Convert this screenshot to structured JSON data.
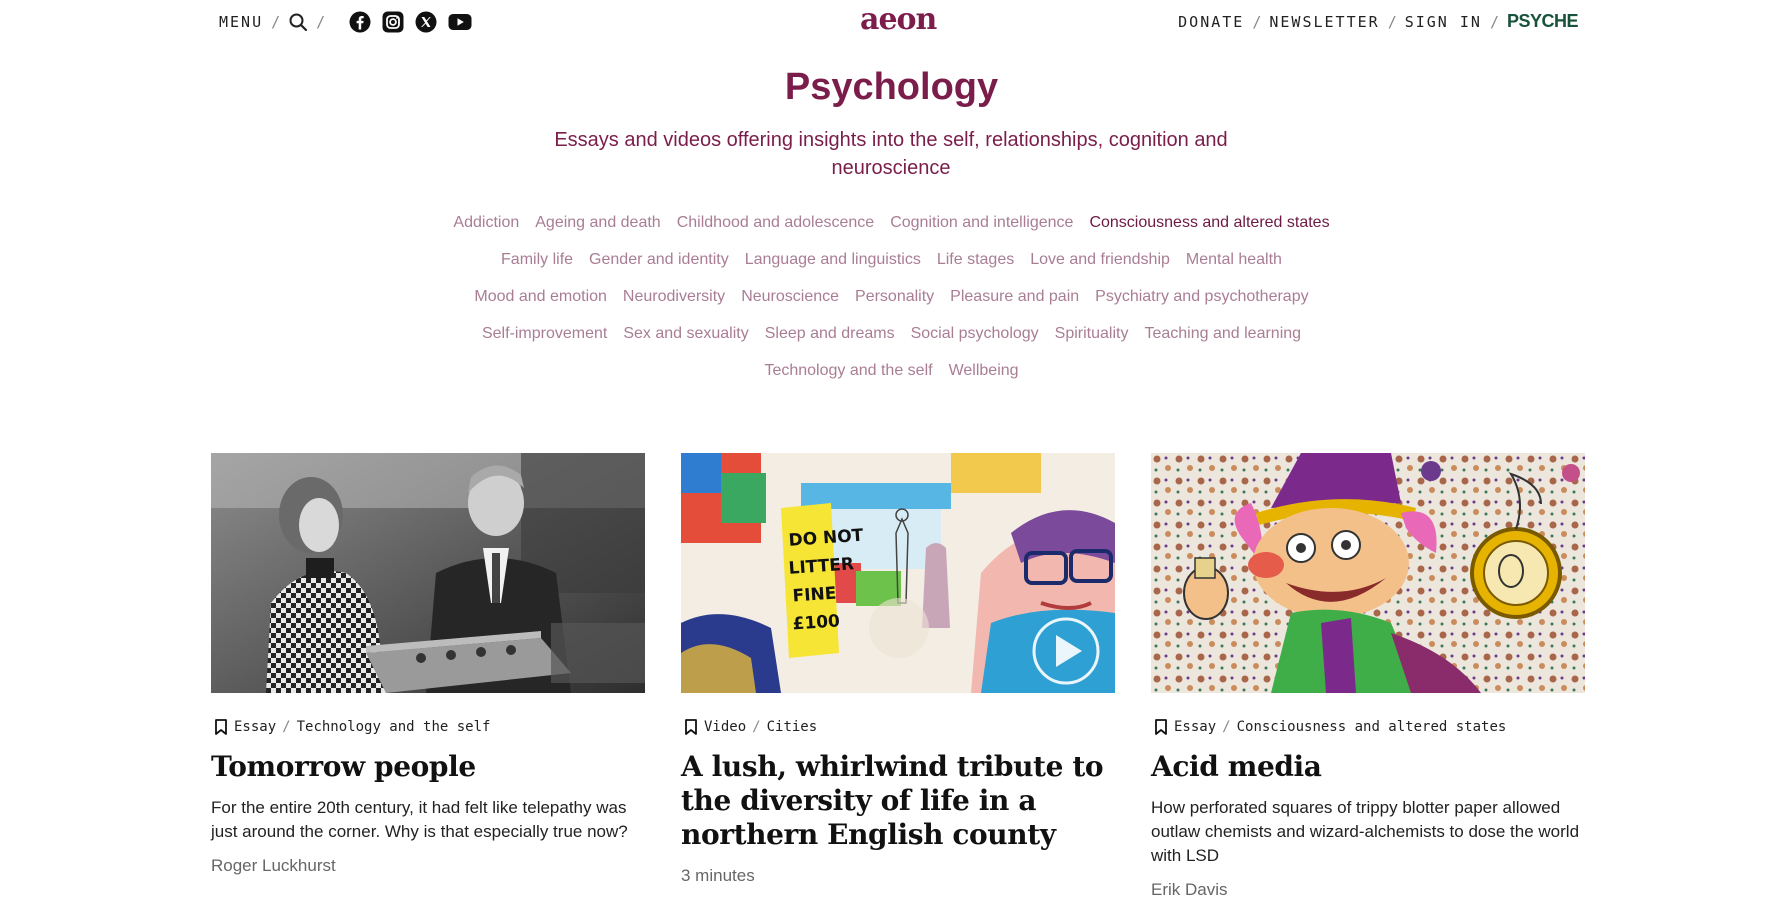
{
  "header": {
    "menu_label": "MENU",
    "logo_text": "aeon",
    "right_links": [
      "DONATE",
      "NEWSLETTER",
      "SIGN IN"
    ],
    "psyche_label": "PSYCHE",
    "social_icons": [
      "facebook-icon",
      "instagram-icon",
      "x-icon",
      "youtube-icon"
    ]
  },
  "page": {
    "title": "Psychology",
    "subtitle": "Essays and videos offering insights into the self, relationships, cognition and neuroscience"
  },
  "topics": [
    {
      "label": "Addiction",
      "active": false
    },
    {
      "label": "Ageing and death",
      "active": false
    },
    {
      "label": "Childhood and adolescence",
      "active": false
    },
    {
      "label": "Cognition and intelligence",
      "active": false
    },
    {
      "label": "Consciousness and altered states",
      "active": true
    },
    {
      "label": "Family life",
      "active": false
    },
    {
      "label": "Gender and identity",
      "active": false
    },
    {
      "label": "Language and linguistics",
      "active": false
    },
    {
      "label": "Life stages",
      "active": false
    },
    {
      "label": "Love and friendship",
      "active": false
    },
    {
      "label": "Mental health",
      "active": false
    },
    {
      "label": "Mood and emotion",
      "active": false
    },
    {
      "label": "Neurodiversity",
      "active": false
    },
    {
      "label": "Neuroscience",
      "active": false
    },
    {
      "label": "Personality",
      "active": false
    },
    {
      "label": "Pleasure and pain",
      "active": false
    },
    {
      "label": "Psychiatry and psychotherapy",
      "active": false
    },
    {
      "label": "Self-improvement",
      "active": false
    },
    {
      "label": "Sex and sexuality",
      "active": false
    },
    {
      "label": "Sleep and dreams",
      "active": false
    },
    {
      "label": "Social psychology",
      "active": false
    },
    {
      "label": "Spirituality",
      "active": false
    },
    {
      "label": "Teaching and learning",
      "active": false
    },
    {
      "label": "Technology and the self",
      "active": false
    },
    {
      "label": "Wellbeing",
      "active": false
    }
  ],
  "cards": [
    {
      "type": "Essay",
      "category": "Technology and the self",
      "title": "Tomorrow people",
      "description": "For the entire 20th century, it had felt like telepathy was just around the corner. Why is that especially true now?",
      "footer": "Roger Luckhurst"
    },
    {
      "type": "Video",
      "category": "Cities",
      "title": "A lush, whirlwind tribute to the diversity of life in a northern English county",
      "description": "",
      "footer": "3 minutes"
    },
    {
      "type": "Essay",
      "category": "Consciousness and altered states",
      "title": "Acid media",
      "description": "How perforated squares of trippy blotter paper allowed outlaw chemists and wizard-alchemists to dose the world with LSD",
      "footer": "Erik Davis"
    }
  ],
  "colors": {
    "brand": "#7c1d4b",
    "topic_link": "#a97d94",
    "psyche_green": "#17533a"
  }
}
